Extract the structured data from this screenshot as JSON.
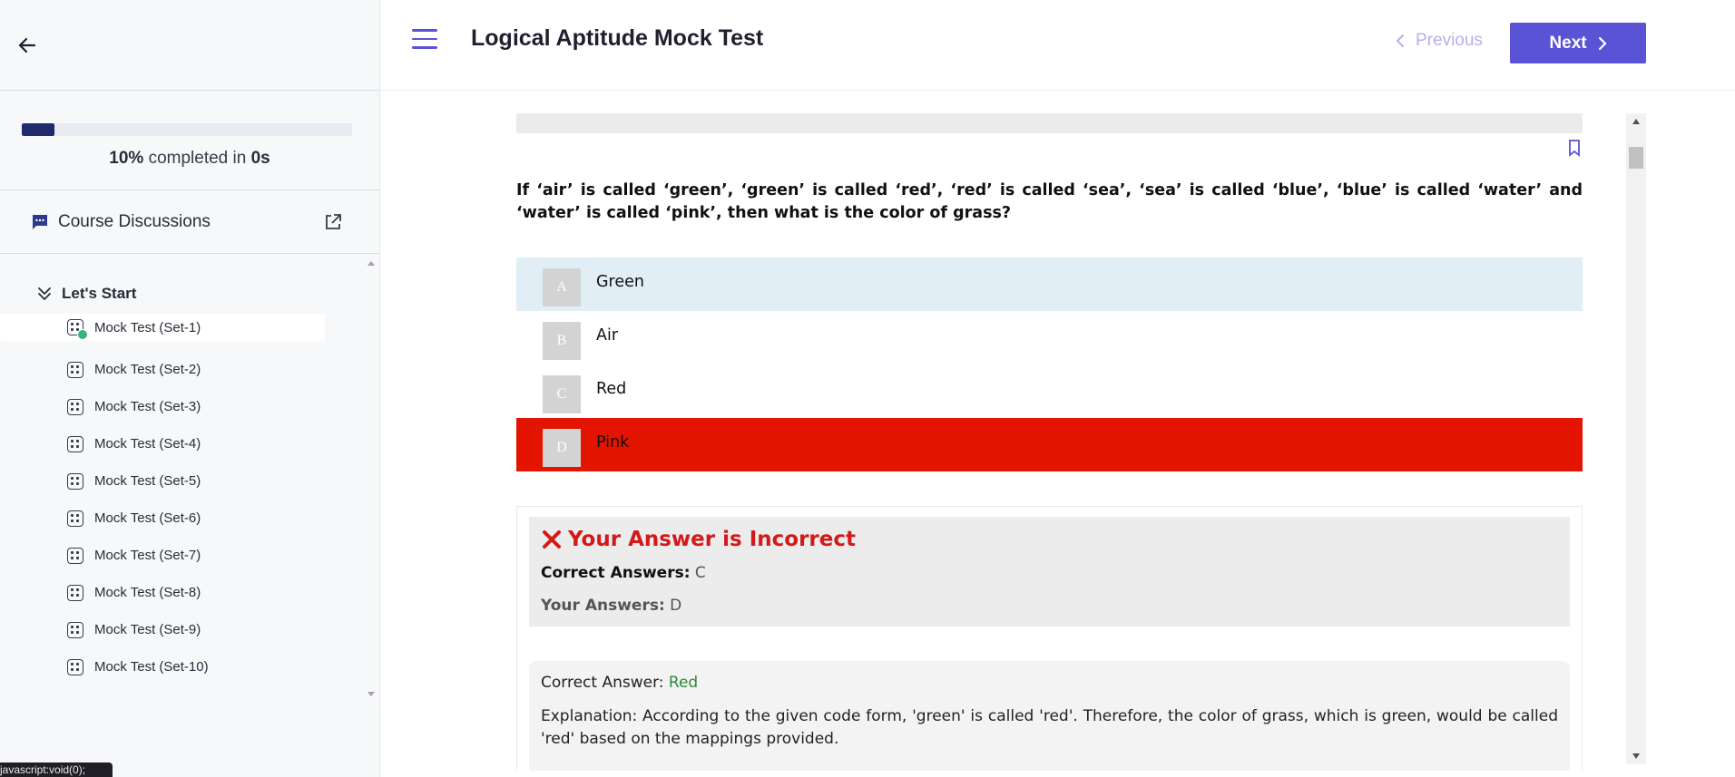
{
  "sidebar": {
    "progress": {
      "percent_label": "10%",
      "middle_text": " completed in ",
      "time_label": "0s",
      "fill_fraction": 0.1,
      "fill_color": "#1e2a6b"
    },
    "discussions_label": "Course Discussions",
    "section_title": "Let's Start",
    "lessons": [
      {
        "label": "Mock Test (Set-1)",
        "completed": true,
        "active": true
      },
      {
        "label": "Mock Test (Set-2)"
      },
      {
        "label": "Mock Test (Set-3)"
      },
      {
        "label": "Mock Test (Set-4)"
      },
      {
        "label": "Mock Test (Set-5)"
      },
      {
        "label": "Mock Test (Set-6)"
      },
      {
        "label": "Mock Test (Set-7)"
      },
      {
        "label": "Mock Test (Set-8)"
      },
      {
        "label": "Mock Test (Set-9)"
      },
      {
        "label": "Mock Test (Set-10)"
      }
    ],
    "status_tip": "javascript:void(0);"
  },
  "header": {
    "title": "Logical Aptitude Mock Test",
    "previous_label": "Previous",
    "next_label": "Next",
    "accent_color": "#5a53d6"
  },
  "question": {
    "text": "If ‘air’ is called ‘green’, ‘green’ is called ‘red’, ‘red’ is called ‘sea’, ‘sea’ is called ‘blue’, ‘blue’ is called ‘water’ and ‘water’ is called ‘pink’, then what is the color of grass?",
    "options": [
      {
        "letter": "A",
        "text": "Green",
        "state": "highlight"
      },
      {
        "letter": "B",
        "text": "Air",
        "state": "none"
      },
      {
        "letter": "C",
        "text": "Red",
        "state": "none"
      },
      {
        "letter": "D",
        "text": "Pink",
        "state": "wrong"
      }
    ]
  },
  "feedback": {
    "title": "Your Answer is Incorrect",
    "correct_label": "Correct Answers:",
    "correct_value": "C",
    "your_label": "Your Answers:",
    "your_value": "D",
    "explanation_answer_label": "Correct Answer:",
    "explanation_answer_value": "Red",
    "explanation_text": "Explanation: According to the given code form, 'green' is called 'red'. Therefore, the color of grass, which is green, would be called 'red' based on the mappings provided."
  }
}
